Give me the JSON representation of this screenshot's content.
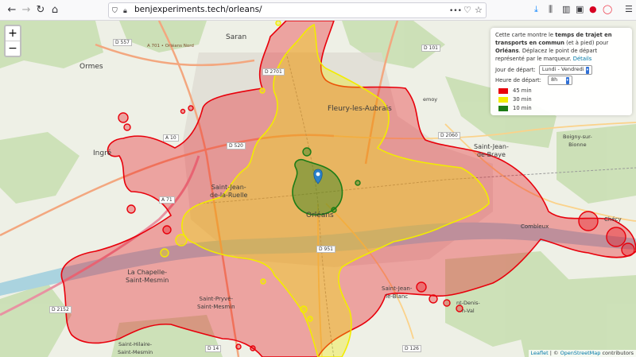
{
  "browser": {
    "url_host": "benjexperiments.tech",
    "url_path": "/orleans/"
  },
  "map": {
    "zoom_in": "+",
    "zoom_out": "−",
    "labels": {
      "saran": "Saran",
      "ormes": "Ormes",
      "ingre": "Ingré",
      "fleury": "Fleury-les-Aubrais",
      "saint_jean_de_braye": "Saint-Jean-\nde-Braye",
      "saint_jean_de_la_ruelle": "Saint-Jean-\nde-la-Ruelle",
      "orleans": "Orléans",
      "chapelle": "La Chapelle-\nSaint-Mesmin",
      "saint_pryve": "Saint-Pryvé-\nSaint-Mesmin",
      "saint_jean_le_blanc": "Saint-Jean-\nle-Blanc",
      "boigny": "Boigny-sur-\nBionne",
      "chécy": "Chécy",
      "combleux": "Combleux",
      "semoy": "emoy",
      "saint_hilaire": "Saint-Hilaire-\nSaint-Mesmin",
      "saint_denis": "nt-Denis-\nn-Val"
    },
    "roads": [
      "D 557",
      "D 101",
      "D 2701",
      "A 10",
      "D 520",
      "A 71",
      "D 2060",
      "D 2152",
      "D 951",
      "D 14",
      "D 126",
      "A 701 • Orléans Nord"
    ]
  },
  "panel": {
    "intro_1": "Cette carte montre le ",
    "intro_bold_1": "temps de trajet en transports en commun",
    "intro_2": " (et à pied) pour ",
    "intro_bold_2": "Orléans",
    "intro_3": ". Déplacez le point de départ représenté par le marqueur. ",
    "details_link": "Détails",
    "day_label": "Jour de départ:",
    "day_value": "Lundi - Vendredi",
    "hour_label": "Heure de départ:",
    "hour_value": "8h",
    "legend": [
      {
        "label": "45 min",
        "color": "#e8000b"
      },
      {
        "label": "30 min",
        "color": "#f2ec00"
      },
      {
        "label": "10 min",
        "color": "#1c7c16"
      }
    ]
  },
  "attribution": {
    "leaflet": "Leaflet",
    "sep": " | © ",
    "osm": "OpenStreetMap",
    "contrib": " contributors"
  },
  "colors": {
    "zone_45": "#e8000b",
    "zone_30": "#f2ec00",
    "zone_10": "#1c7c16",
    "marker": "#2a81cb"
  }
}
